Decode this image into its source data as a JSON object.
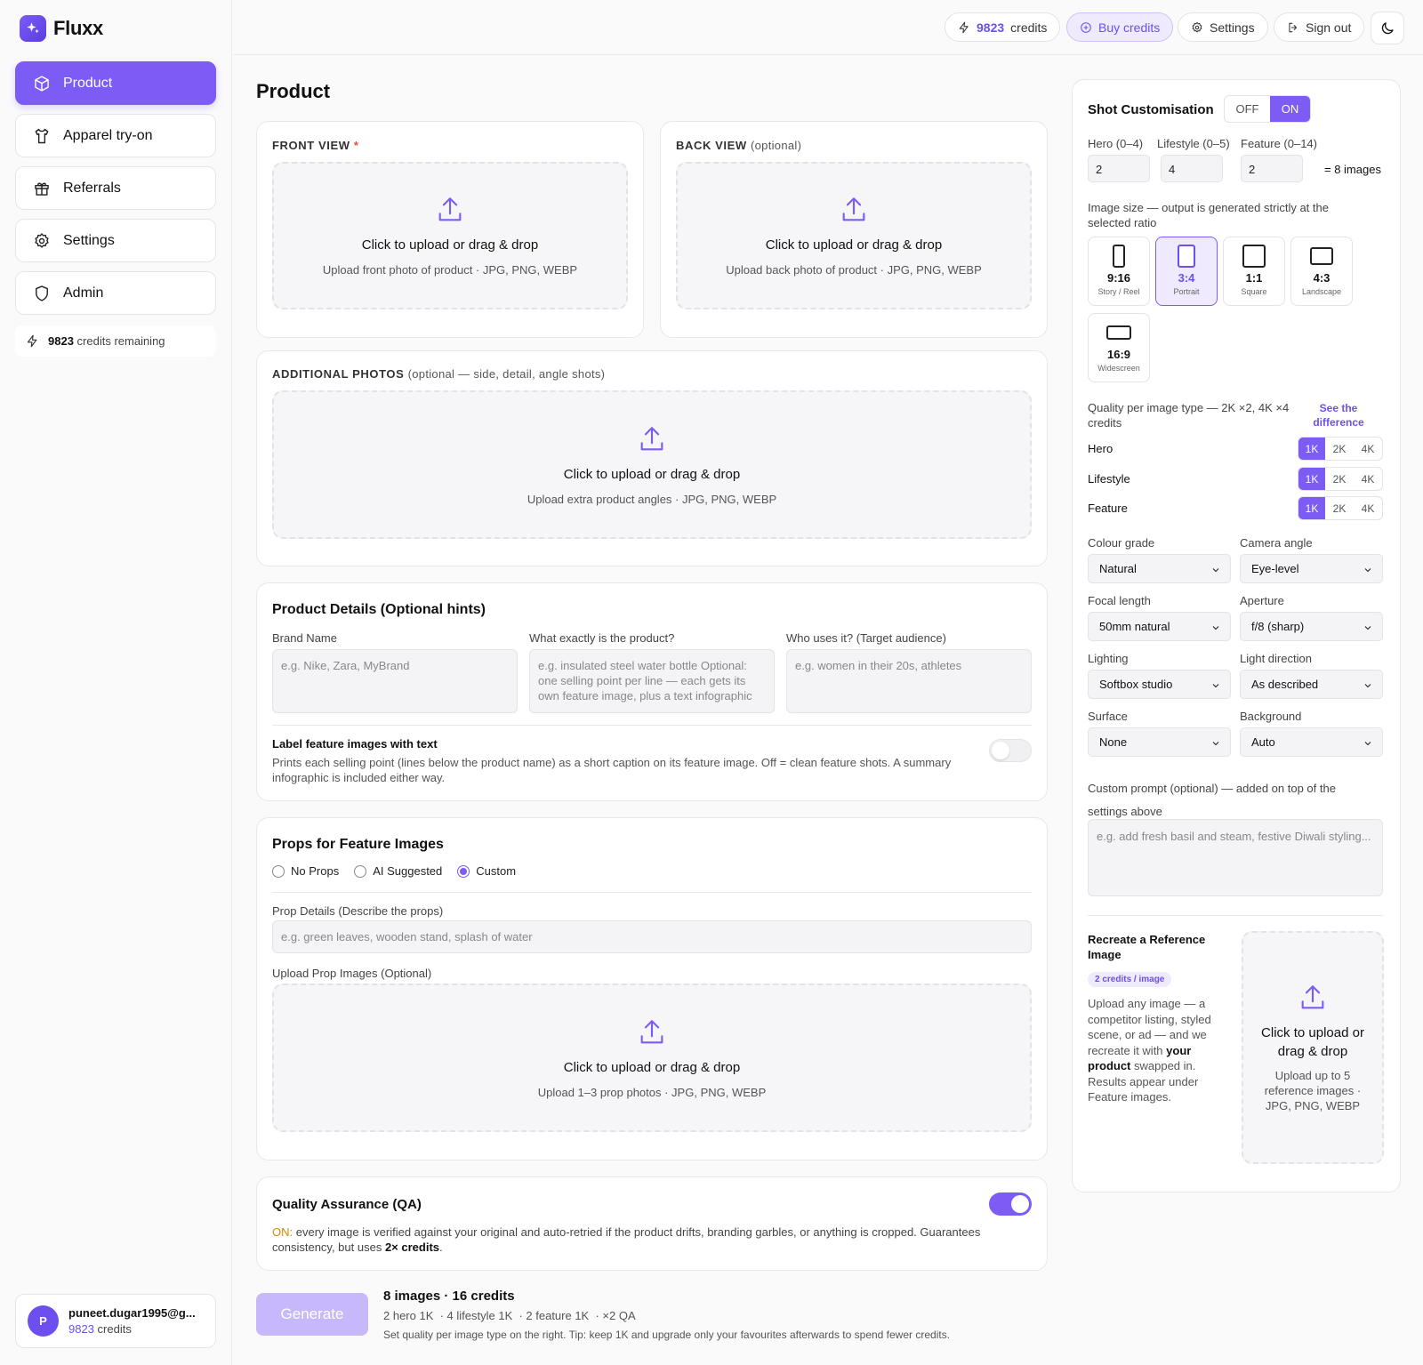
{
  "app": {
    "name": "Fluxx"
  },
  "sidebar": {
    "items": [
      {
        "label": "Product",
        "icon": "cube-icon"
      },
      {
        "label": "Apparel try-on",
        "icon": "shirt-icon"
      },
      {
        "label": "Referrals",
        "icon": "gift-icon"
      },
      {
        "label": "Settings",
        "icon": "gear-icon"
      },
      {
        "label": "Admin",
        "icon": "shield-icon"
      }
    ],
    "credits_value": "9823",
    "credits_suffix": "credits remaining",
    "user": {
      "initial": "P",
      "email": "puneet.dugar1995@g...",
      "credits_value": "9823",
      "credits_suffix": "credits"
    }
  },
  "topbar": {
    "credits_value": "9823",
    "credits_suffix": "credits",
    "buy": "Buy credits",
    "settings": "Settings",
    "signout": "Sign out"
  },
  "main": {
    "title": "Product",
    "front": {
      "label": "FRONT VIEW",
      "required": "*",
      "drop_title": "Click to upload or drag & drop",
      "drop_sub": "Upload front photo of product · JPG, PNG, WEBP"
    },
    "back": {
      "label": "BACK VIEW",
      "optional": "(optional)",
      "drop_title": "Click to upload or drag & drop",
      "drop_sub": "Upload back photo of product · JPG, PNG, WEBP"
    },
    "additional": {
      "label": "ADDITIONAL PHOTOS",
      "optional": "(optional — side, detail, angle shots)",
      "drop_title": "Click to upload or drag & drop",
      "drop_sub": "Upload extra product angles · JPG, PNG, WEBP"
    },
    "details": {
      "title": "Product Details (Optional hints)",
      "brand_label": "Brand Name",
      "brand_placeholder": "e.g. Nike, Zara, MyBrand",
      "product_label": "What exactly is the product?",
      "product_placeholder": "e.g. insulated steel water bottle Optional: one selling point per line — each gets its own feature image, plus a text infographic",
      "audience_label": "Who uses it? (Target audience)",
      "audience_placeholder": "e.g. women in their 20s, athletes",
      "label_toggle_title": "Label feature images with text",
      "label_toggle_desc": "Prints each selling point (lines below the product name) as a short caption on its feature image. Off = clean feature shots. A summary infographic is included either way."
    },
    "props": {
      "title": "Props for Feature Images",
      "options": [
        "No Props",
        "AI Suggested",
        "Custom"
      ],
      "selected": "Custom",
      "detail_label": "Prop Details (Describe the props)",
      "detail_placeholder": "e.g. green leaves, wooden stand, splash of water",
      "upload_label": "Upload Prop Images (Optional)",
      "drop_title": "Click to upload or drag & drop",
      "drop_sub": "Upload 1–3 prop photos · JPG, PNG, WEBP"
    },
    "qa": {
      "title": "Quality Assurance (QA)",
      "on_prefix": "ON:",
      "desc": " every image is verified against your original and auto-retried if the product drifts, branding garbles, or anything is cropped. Guarantees consistency, but uses ",
      "desc_bold": "2× credits",
      "desc_end": ".",
      "enabled": true
    },
    "footer": {
      "generate": "Generate",
      "summary": "8 images · 16 credits",
      "breakdown": "2 hero 1K  · 4 lifestyle 1K  · 2 feature 1K  · ×2 QA",
      "tip": "Set quality per image type on the right. Tip: keep 1K and upgrade only your favourites afterwards to spend fewer credits."
    }
  },
  "panel": {
    "title": "Shot Customisation",
    "off": "OFF",
    "on": "ON",
    "hero_label": "Hero (0–4)",
    "hero": "2",
    "lifestyle_label": "Lifestyle (0–5)",
    "lifestyle": "4",
    "feature_label": "Feature (0–14)",
    "feature": "2",
    "total": "= 8 images",
    "size_label": "Image size — output is generated strictly at the selected ratio",
    "ratios": [
      {
        "ratio": "9:16",
        "name": "Story / Reel"
      },
      {
        "ratio": "3:4",
        "name": "Portrait"
      },
      {
        "ratio": "1:1",
        "name": "Square"
      },
      {
        "ratio": "4:3",
        "name": "Landscape"
      },
      {
        "ratio": "16:9",
        "name": "Widescreen"
      }
    ],
    "selected_ratio": "3:4",
    "quality_label": "Quality per image type — 2K ×2, 4K ×4 credits",
    "see_diff": "See the difference",
    "quality_rows": [
      {
        "name": "Hero",
        "selected": "1K"
      },
      {
        "name": "Lifestyle",
        "selected": "1K"
      },
      {
        "name": "Feature",
        "selected": "1K"
      }
    ],
    "quality_options": [
      "1K",
      "2K",
      "4K"
    ],
    "selects": [
      {
        "label": "Colour grade",
        "value": "Natural"
      },
      {
        "label": "Camera angle",
        "value": "Eye-level"
      },
      {
        "label": "Focal length",
        "value": "50mm natural"
      },
      {
        "label": "Aperture",
        "value": "f/8 (sharp)"
      },
      {
        "label": "Lighting",
        "value": "Softbox studio"
      },
      {
        "label": "Light direction",
        "value": "As described"
      },
      {
        "label": "Surface",
        "value": "None"
      },
      {
        "label": "Background",
        "value": "Auto"
      }
    ],
    "custom_label": "Custom prompt (optional) — added on top of the settings above",
    "custom_placeholder": "e.g. add fresh basil and steam, festive Diwali styling...",
    "recreate": {
      "title": "Recreate a Reference Image",
      "badge": "2 credits / image",
      "desc_a": "Upload any image — a competitor listing, styled scene, or ad — and we recreate it with ",
      "desc_bold": "your product",
      "desc_b": " swapped in. Results appear under Feature images.",
      "drop_title": "Click to upload or drag & drop",
      "drop_sub": "Upload up to 5 reference images · JPG, PNG, WEBP"
    }
  },
  "colors": {
    "accent": "#7c5cf5",
    "accent_soft": "#efeafe",
    "warn": "#d98a00"
  }
}
